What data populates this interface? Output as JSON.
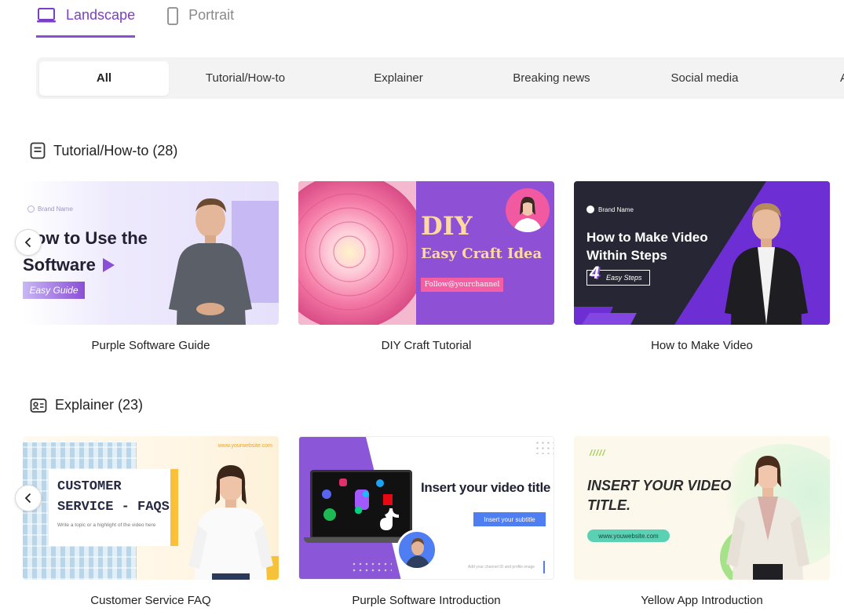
{
  "orientation_tabs": [
    {
      "label": "Landscape",
      "active": true,
      "icon": "laptop-icon"
    },
    {
      "label": "Portrait",
      "active": false,
      "icon": "phone-icon"
    }
  ],
  "categories": [
    {
      "label": "All",
      "active": true
    },
    {
      "label": "Tutorial/How-to",
      "active": false
    },
    {
      "label": "Explainer",
      "active": false
    },
    {
      "label": "Breaking news",
      "active": false
    },
    {
      "label": "Social media",
      "active": false
    },
    {
      "label": "Ac",
      "active": false
    }
  ],
  "sections": [
    {
      "title": "Tutorial/How-to (28)",
      "icon": "document-icon",
      "cards": [
        {
          "caption": "Purple Software Guide",
          "thumb": {
            "brand": "Brand Name",
            "line1": "How to Use the",
            "line2": "Software",
            "badge": "Easy Guide"
          }
        },
        {
          "caption": "DIY Craft Tutorial",
          "thumb": {
            "title": "DIY",
            "subtitle": "Easy Craft Idea",
            "button": "Follow@yourchannel"
          }
        },
        {
          "caption": "How to Make Video",
          "thumb": {
            "brand": "Brand Name",
            "line1": "How to Make Video",
            "line2": "Within Steps",
            "number": "4",
            "steps": "Easy Steps"
          }
        }
      ]
    },
    {
      "title": "Explainer (23)",
      "icon": "id-card-icon",
      "cards": [
        {
          "caption": "Customer Service FAQ",
          "thumb": {
            "website": "www.yourwebsite.com",
            "line1": "CUSTOMER",
            "line2": "SERVICE - FAQS",
            "sub": "Write a topic or a highlight of the video here"
          }
        },
        {
          "caption": "Purple Software Introduction",
          "thumb": {
            "title": "Insert your video title",
            "subtitle": "Insert your subtitle",
            "footer": "Add your channel ID and profile image"
          }
        },
        {
          "caption": "Yellow App Introduction",
          "thumb": {
            "ticks": "/////",
            "line1": "INSERT YOUR VIDEO",
            "line2": "TITLE.",
            "url": "www.youwebsite.com"
          }
        }
      ]
    }
  ],
  "colors": {
    "accent": "#8b4fd6",
    "accent_text": "#7a3fc9",
    "pill_bg": "#f3f3f4"
  }
}
